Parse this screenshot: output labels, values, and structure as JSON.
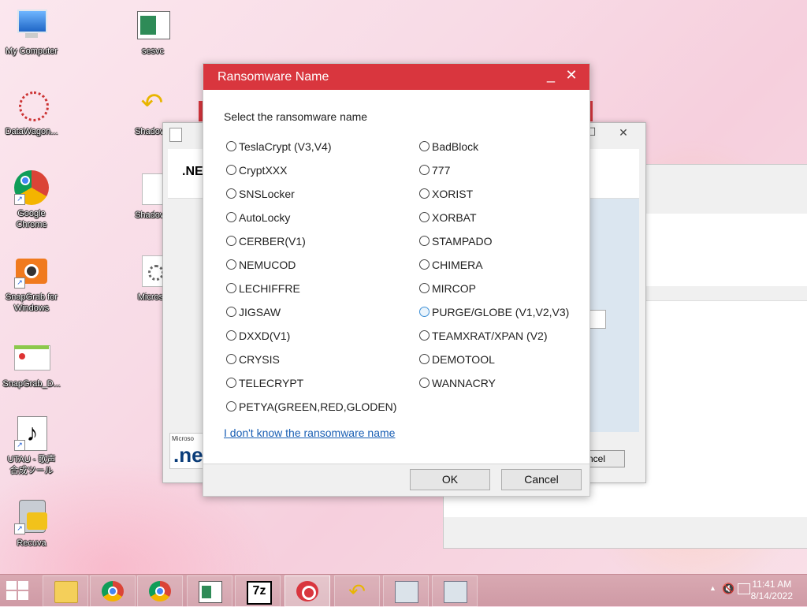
{
  "desktop": {
    "icons": [
      {
        "label": "My Computer"
      },
      {
        "label": "DataWagon..."
      },
      {
        "label": "Google\nChrome"
      },
      {
        "label": "SnapGrab for\nWindows"
      },
      {
        "label": "SnapGrab_D..."
      },
      {
        "label": "UTAU - 歌声\n合成ツール"
      },
      {
        "label": "Recuva"
      },
      {
        "label": "sesvc"
      },
      {
        "label": "Shadowb"
      },
      {
        "label": "Shadowb"
      },
      {
        "label": "Microso"
      }
    ]
  },
  "background_window": {
    "banner_text": ".NE",
    "logo_small": "Microso",
    "logo_big": ".ne",
    "cancel_label": "ncel"
  },
  "dialog": {
    "title": "Ransomware Name",
    "minimize_glyph": "_",
    "close_glyph": "✕",
    "prompt": "Select the ransomware name",
    "left_options": [
      "TeslaCrypt (V3,V4)",
      "CryptXXX",
      "SNSLocker",
      "AutoLocky",
      "CERBER(V1)",
      "NEMUCOD",
      "LECHIFFRE",
      "JIGSAW",
      "DXXD(V1)",
      "CRYSIS",
      "TELECRYPT",
      "PETYA(GREEN,RED,GLODEN)"
    ],
    "right_options": [
      "BadBlock",
      "777",
      "XORIST",
      "XORBAT",
      "STAMPADO",
      "CHIMERA",
      "MIRCOP",
      "PURGE/GLOBE (V1,V2,V3)",
      "TEAMXRAT/XPAN (V2)",
      "DEMOTOOL",
      "WANNACRY"
    ],
    "hovered_option": "PURGE/GLOBE (V1,V2,V3)",
    "unknown_link": "I don't know the ransomware name",
    "ok_label": "OK",
    "cancel_label": "Cancel"
  },
  "taskbar": {
    "apps": [
      "file-explorer-icon",
      "chrome-icon",
      "chrome-icon",
      "window-icon",
      "7zip-icon",
      "trend-micro-icon",
      "shadow-icon",
      "installer-icon",
      "installer-icon"
    ],
    "sevenzip_text": "7z",
    "time": "11:41 AM",
    "date": "8/14/2022"
  },
  "colors": {
    "dialog_title_bg": "#d9363e",
    "link": "#1a5fb4"
  }
}
